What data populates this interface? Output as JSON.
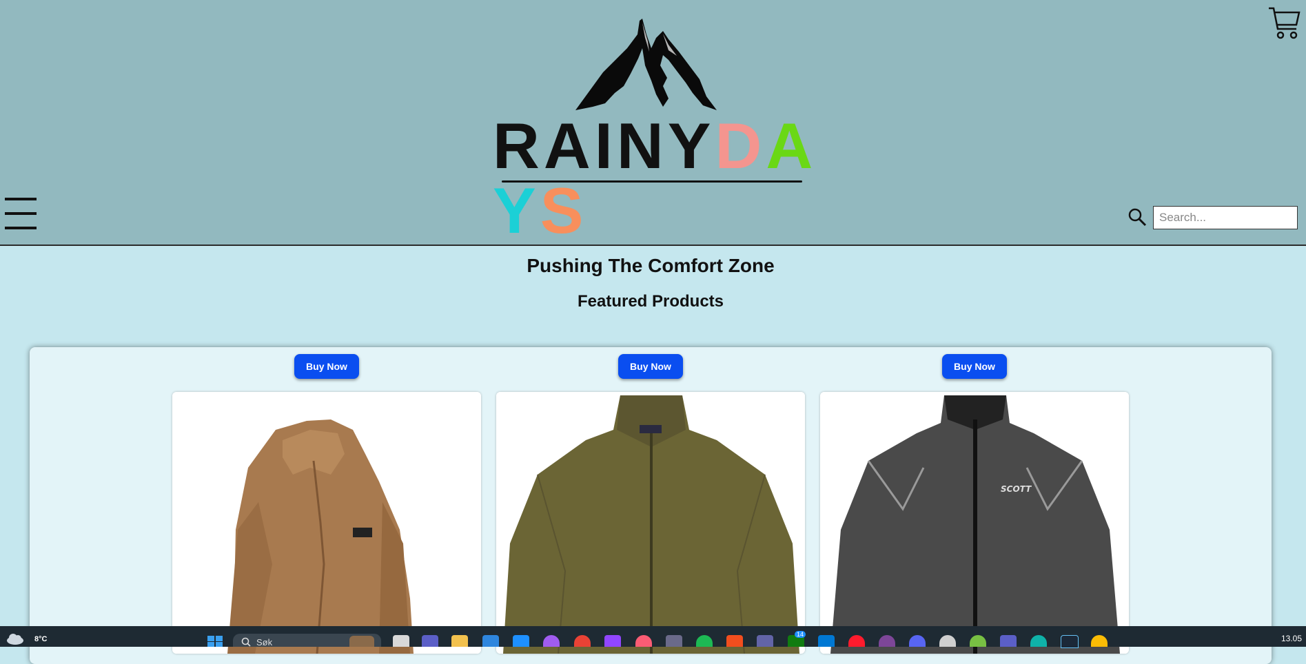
{
  "header": {
    "logo": {
      "word1": "RAINY",
      "word2_letters": [
        {
          "char": "D",
          "color": "#f4958f"
        },
        {
          "char": "A",
          "color": "#6ad815"
        },
        {
          "char": "Y",
          "color": "#1bd0d6"
        },
        {
          "char": "S",
          "color": "#f88f5c"
        }
      ]
    },
    "search_placeholder": "Search..."
  },
  "main": {
    "title": "Pushing The Comfort Zone",
    "subtitle": "Featured Products",
    "products": [
      {
        "button_label": "Buy Now",
        "image": "brown-fleece-jacket"
      },
      {
        "button_label": "Buy Now",
        "image": "olive-zip-fleece-jacket"
      },
      {
        "button_label": "Buy Now",
        "image": "black-scott-wind-jacket"
      }
    ]
  },
  "taskbar": {
    "weather_temp": "8°C",
    "search_text": "Søk",
    "badge_count": "14",
    "clock": "13.05",
    "apps": [
      "start-icon",
      "explorer-icon",
      "teams-icon",
      "files-icon",
      "store-icon",
      "mail-icon",
      "messenger-icon",
      "chrome-icon",
      "twitch-icon",
      "itunes-icon",
      "obs-icon",
      "spotify-icon",
      "figma-icon",
      "teams2-icon",
      "xbox-icon",
      "vscode-icon",
      "opera-icon",
      "tor-icon",
      "discord-icon",
      "settings-icon",
      "utorrent-icon",
      "teams3-icon",
      "edge-icon",
      "steam-icon",
      "chrome2-icon"
    ]
  },
  "colors": {
    "header_bg": "#92b9bf",
    "page_bg": "#c5e7ee",
    "button_blue": "#0a4ef0"
  }
}
